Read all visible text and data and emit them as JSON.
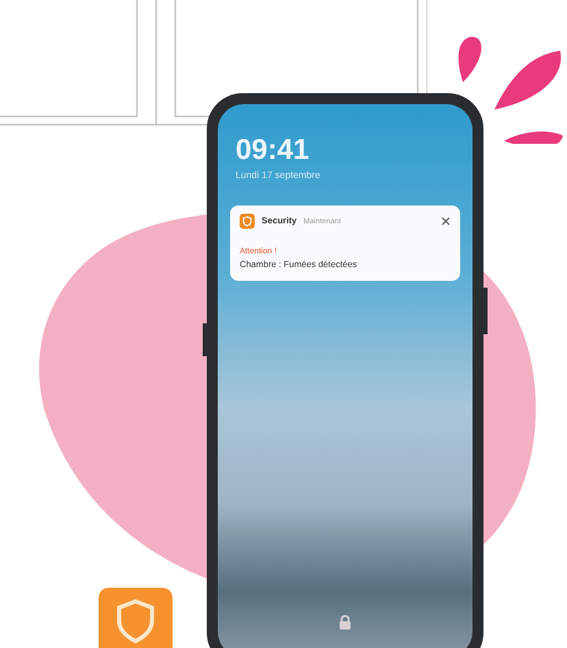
{
  "lock_screen": {
    "time": "09:41",
    "date": "Lundi 17 septembre"
  },
  "notification": {
    "app_name": "Security",
    "timestamp": "Maintenant",
    "title": "Attention !",
    "message": "Chambre : Fumées détectées"
  }
}
